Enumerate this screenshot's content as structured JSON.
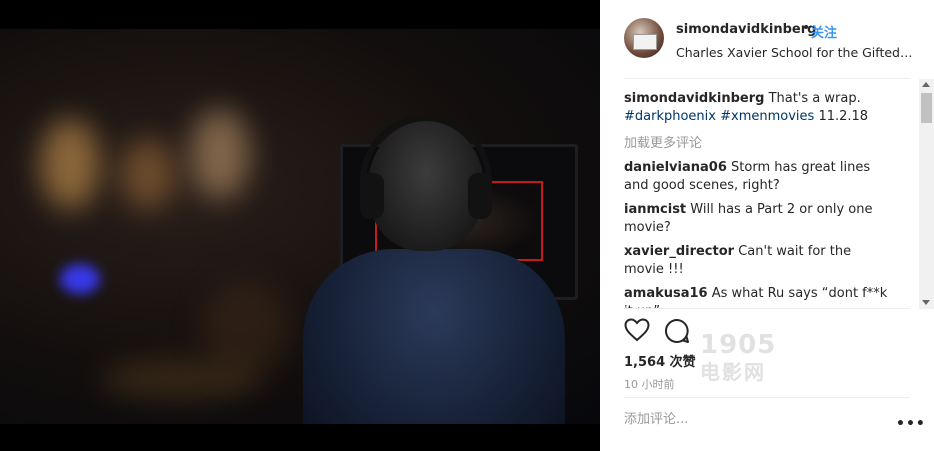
{
  "post": {
    "username": "simondavidkinberg",
    "separator": "•",
    "follow_label": "关注",
    "location": "Charles Xavier School for the Gifted Youngsters"
  },
  "caption": {
    "username": "simondavidkinberg",
    "text": "That's a wrap.",
    "hashtag1": "#darkphoenix",
    "hashtag2": "#xmenmovies",
    "date": "11.2.18"
  },
  "load_more_label": "加载更多评论",
  "comments": [
    {
      "username": "danielviana06",
      "text": "Storm has great lines and good scenes, right?"
    },
    {
      "username": "ianmcist",
      "text": "Will has a Part 2 or only one movie?"
    },
    {
      "username": "xavier_director",
      "text": "Can't wait for the movie !!!"
    },
    {
      "username": "amakusa16",
      "text": "As what Ru says “dont f**k it up”"
    }
  ],
  "likes": "1,564 次赞",
  "time_ago": "10 小时前",
  "add_comment_placeholder": "添加评论...",
  "more_label": "•••",
  "watermark": {
    "number": "1905",
    "text": "电影网"
  },
  "icons": {
    "like": "heart-icon",
    "comment": "comment-icon",
    "more": "more-options-icon"
  },
  "colors": {
    "link": "#3897f0",
    "hashtag": "#003569",
    "text": "#262626",
    "muted": "#999999"
  }
}
